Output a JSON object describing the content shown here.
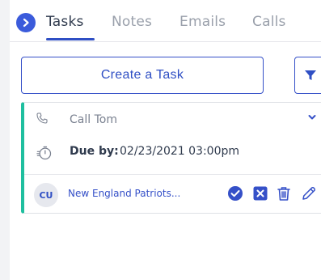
{
  "tabs": [
    {
      "label": "Tasks",
      "active": true
    },
    {
      "label": "Notes",
      "active": false
    },
    {
      "label": "Emails",
      "active": false
    },
    {
      "label": "Calls",
      "active": false
    }
  ],
  "toolbar": {
    "create_label": "Create a Task",
    "filter_icon": "filter-icon"
  },
  "task": {
    "type_icon": "phone-icon",
    "title": "Call Tom",
    "due_label": "Due by:",
    "due_value": "02/23/2021 03:00pm",
    "avatar_initials": "CU",
    "related_to": "New England Patriots...",
    "accent_color": "#1fbf9f",
    "actions": [
      "complete-icon",
      "close-icon",
      "trash-icon",
      "edit-icon"
    ]
  },
  "colors": {
    "primary": "#2f4fc4",
    "accent": "#1fbf9f",
    "muted_text": "#9aa0ab"
  }
}
